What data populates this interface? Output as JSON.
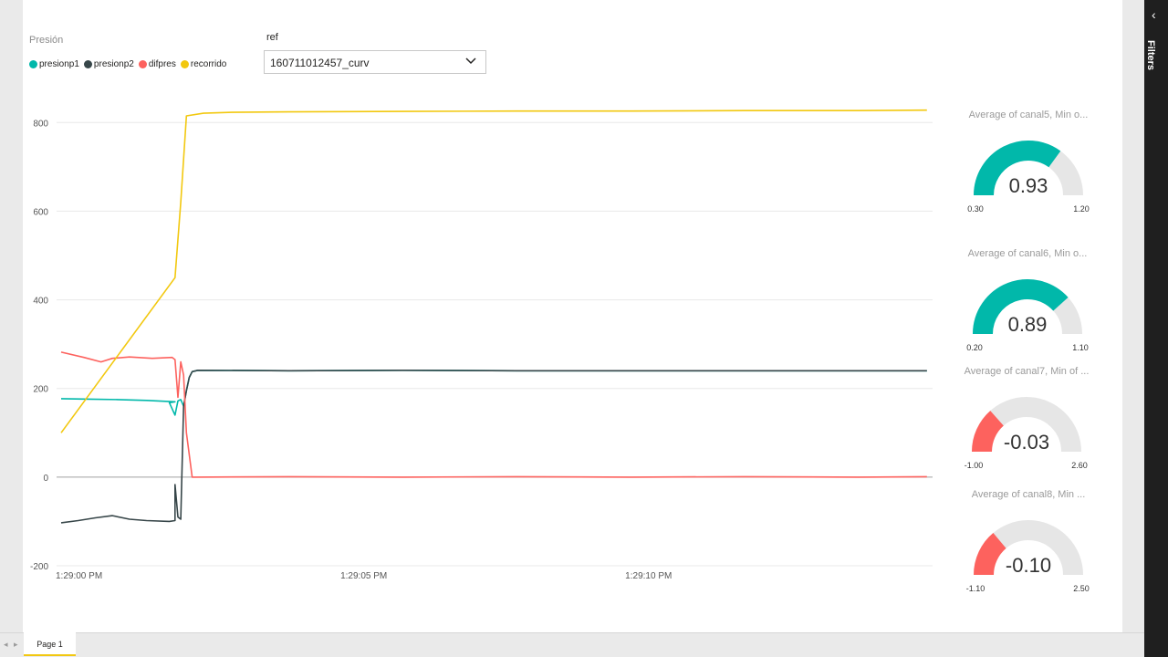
{
  "filters_pane": {
    "label": "Filters",
    "collapse_icon": "chevron-left-icon"
  },
  "legend": {
    "title": "Presión",
    "items": [
      {
        "label": "presionp1",
        "color": "#01b8aa"
      },
      {
        "label": "presionp2",
        "color": "#374649"
      },
      {
        "label": "difpres",
        "color": "#fd625e"
      },
      {
        "label": "recorrido",
        "color": "#f2c80f"
      }
    ]
  },
  "slicer": {
    "title": "ref",
    "value": "160711012457_curv",
    "icon": "chevron-down-icon"
  },
  "chart_data": {
    "type": "line",
    "x_ticks": [
      "1:29:00 PM",
      "1:29:05 PM",
      "1:29:10 PM"
    ],
    "y_ticks": [
      "800",
      "600",
      "400",
      "200",
      "0",
      "-200"
    ],
    "ylim": [
      -200,
      850
    ],
    "x_unit": "seconds after 1:29:00 PM",
    "xlim": [
      0,
      15.3
    ],
    "grid": true,
    "series": [
      {
        "name": "presionp1",
        "color": "#01b8aa",
        "x": [
          0,
          0.5,
          1.0,
          1.5,
          2.0,
          1.9,
          2.0,
          2.05,
          2.1,
          2.15,
          2.2,
          2.25,
          2.3,
          2.4,
          4,
          6,
          8,
          10,
          12,
          14,
          15.2
        ],
        "y": [
          177,
          176,
          175,
          173,
          170,
          168,
          140,
          172,
          175,
          160,
          195,
          225,
          238,
          241,
          240,
          241,
          240,
          240,
          240,
          240,
          240
        ]
      },
      {
        "name": "presionp2",
        "color": "#374649",
        "x": [
          0,
          0.3,
          0.6,
          0.9,
          1.2,
          1.5,
          1.9,
          2.0,
          2.0,
          2.05,
          2.1,
          2.15,
          2.2,
          2.25,
          2.3,
          2.4,
          4,
          6,
          8,
          10,
          12,
          14,
          15.2
        ],
        "y": [
          -103,
          -98,
          -92,
          -87,
          -95,
          -98,
          -100,
          -98,
          -17,
          -90,
          -95,
          160,
          195,
          225,
          238,
          241,
          240,
          241,
          240,
          240,
          240,
          240,
          240
        ]
      },
      {
        "name": "difpres",
        "color": "#fd625e",
        "x": [
          0,
          0.4,
          0.7,
          0.9,
          1.2,
          1.6,
          1.95,
          2.0,
          2.05,
          2.1,
          2.15,
          2.2,
          2.3,
          4,
          6,
          8,
          10,
          12,
          14,
          15.2
        ],
        "y": [
          282,
          270,
          260,
          268,
          271,
          268,
          270,
          265,
          180,
          260,
          230,
          100,
          0,
          1,
          0,
          1,
          0,
          1,
          0,
          1
        ]
      },
      {
        "name": "recorrido",
        "color": "#f2c80f",
        "x": [
          0,
          2.0,
          2.1,
          2.2,
          2.5,
          3,
          4,
          6,
          8,
          10,
          12,
          14,
          15.2
        ],
        "y": [
          100,
          450,
          620,
          815,
          821,
          823,
          824,
          825,
          826,
          826,
          827,
          827,
          828
        ]
      }
    ]
  },
  "gauges": [
    {
      "title": "Average of canal5, Min o...",
      "value": 0.93,
      "value_label": "0.93",
      "min": 0.3,
      "max": 1.2,
      "min_label": "0.30",
      "max_label": "1.20",
      "color": "#01b8aa"
    },
    {
      "title": "Average of canal6, Min o...",
      "value": 0.89,
      "value_label": "0.89",
      "min": 0.2,
      "max": 1.1,
      "min_label": "0.20",
      "max_label": "1.10",
      "color": "#01b8aa"
    },
    {
      "title": "Average of canal7, Min of ...",
      "value": -0.03,
      "value_label": "-0.03",
      "min": -1.0,
      "max": 2.6,
      "min_label": "-1.00",
      "max_label": "2.60",
      "color": "#fd625e"
    },
    {
      "title": "Average of canal8, Min ...",
      "value": -0.1,
      "value_label": "-0.10",
      "min": -1.1,
      "max": 2.5,
      "min_label": "-1.10",
      "max_label": "2.50",
      "color": "#fd625e"
    }
  ],
  "pages": {
    "tabs": [
      "Page 1"
    ],
    "prev_icon": "arrow-left-icon",
    "next_icon": "arrow-right-icon"
  }
}
